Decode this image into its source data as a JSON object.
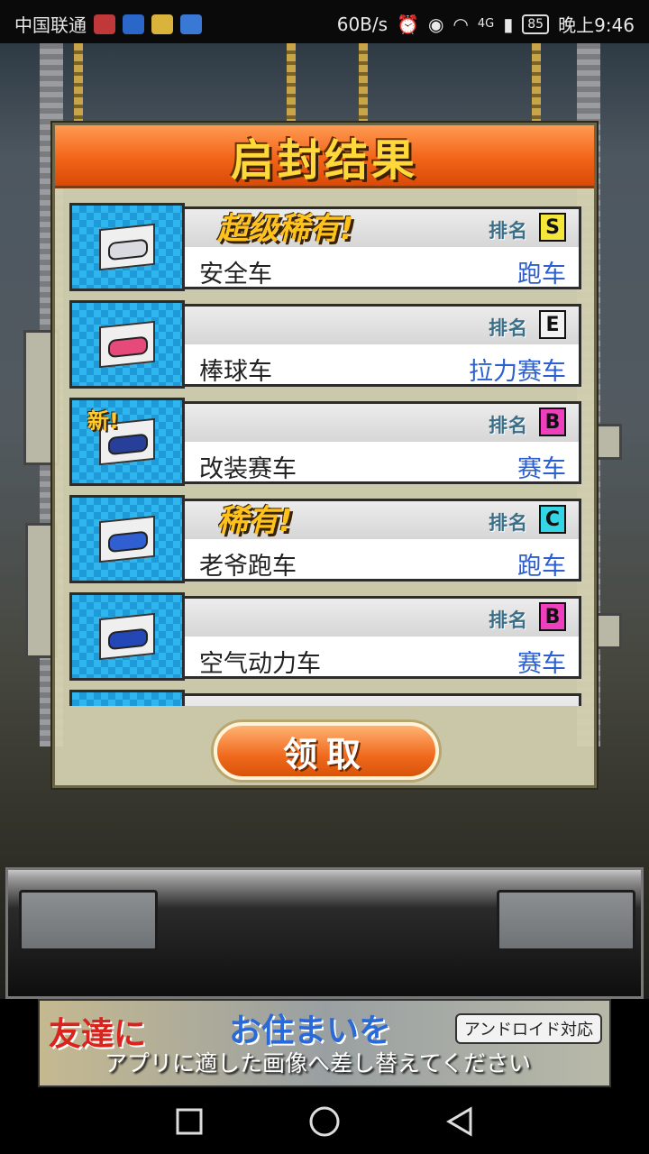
{
  "status_bar": {
    "carrier": "中国联通",
    "speed": "60B/s",
    "network": "4G",
    "battery": "85",
    "time": "晚上9:46"
  },
  "dialog": {
    "title": "启封结果",
    "rank_word": "排名",
    "items": [
      {
        "tag": "超级稀有!",
        "new": "",
        "name": "安全车",
        "class": "跑车",
        "grade": "S",
        "grade_color": "#f5e63a",
        "car_color": "#d9dbe0"
      },
      {
        "tag": "",
        "new": "",
        "name": "棒球车",
        "class": "拉力赛车",
        "grade": "E",
        "grade_color": "#f2f2f2",
        "car_color": "#e64a7a"
      },
      {
        "tag": "",
        "new": "新!",
        "name": "改装赛车",
        "class": "赛车",
        "grade": "B",
        "grade_color": "#ef3fbf",
        "car_color": "#283f9a"
      },
      {
        "tag": "稀有!",
        "new": "",
        "name": "老爷跑车",
        "class": "跑车",
        "grade": "C",
        "grade_color": "#34d6e6",
        "car_color": "#2f5fd1"
      },
      {
        "tag": "",
        "new": "",
        "name": "空气动力车",
        "class": "赛车",
        "grade": "B",
        "grade_color": "#ef3fbf",
        "car_color": "#2447b8"
      }
    ],
    "claim_button": "领取"
  },
  "ad": {
    "text_left": "友達に",
    "text_mid": "お住まいを",
    "badge": "アンドロイド対応",
    "overlay": "アプリに適した画像へ差し替えてください"
  },
  "colors": {
    "title_orange": "#f26418",
    "title_text": "#ffd83a",
    "class_blue": "#2c5fcf"
  }
}
